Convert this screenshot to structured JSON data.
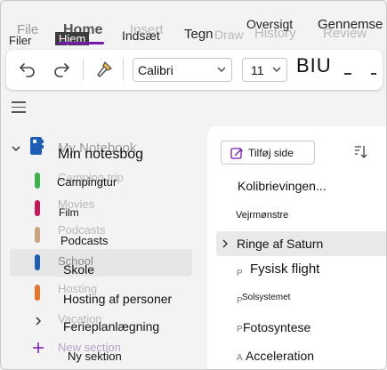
{
  "ribbon": {
    "tabs": [
      {
        "label": "Filer",
        "ghost": "File"
      },
      {
        "label": "Hjem",
        "ghost": "Home"
      },
      {
        "label": "Indsæt",
        "ghost": "Insert"
      },
      {
        "label": "Tegn",
        "ghost": "Draw"
      },
      {
        "label": "Oversigt",
        "ghost": "History"
      },
      {
        "label": "Gennemse",
        "ghost": "Review"
      }
    ],
    "active_tab": "Hjem"
  },
  "toolbar": {
    "font_name": "Calibri",
    "font_size": "11",
    "format_label": "BIU"
  },
  "notebook": {
    "name": "Min notesbog",
    "ghost_name": "My Notebook",
    "sections": [
      {
        "label": "Campingtur",
        "ghost": "Camping trip",
        "color": "#3bb34a"
      },
      {
        "label": "Film",
        "ghost": "Movies",
        "color": "#c4185c"
      },
      {
        "label": "Podcasts",
        "ghost": "Podcasts",
        "color": "#c9a37c"
      },
      {
        "label": "Skole",
        "ghost": "School",
        "color": "#1e5fb5",
        "selected": true
      },
      {
        "label": "Hosting af personer",
        "ghost": "Hosting",
        "color": "#e8742a"
      }
    ],
    "group": {
      "label": "Ferieplanlægning",
      "ghost": "Vacation"
    },
    "new_section": {
      "label": "Ny sektion",
      "ghost": "New section"
    }
  },
  "pages": {
    "add_page_label": "Tilføj side",
    "items": [
      {
        "label": "Kolibrievingen...",
        "ghost": "",
        "size": 14
      },
      {
        "label": "Vejrmønstre",
        "ghost": "",
        "size": 11
      },
      {
        "label": "Ringe af Saturn",
        "ghost": "",
        "size": 14,
        "selected": true
      },
      {
        "label": "Fysisk flight",
        "ghost": "P",
        "size": 15
      },
      {
        "label": "Solsystemet",
        "ghost": "P",
        "size": 10
      },
      {
        "label": "Fotosyntese",
        "ghost": "P",
        "size": 14
      },
      {
        "label": "Acceleration",
        "ghost": "A",
        "size": 14
      }
    ]
  },
  "colors": {
    "accent": "#7719aa",
    "notebook_icon": "#1e5fb5"
  }
}
